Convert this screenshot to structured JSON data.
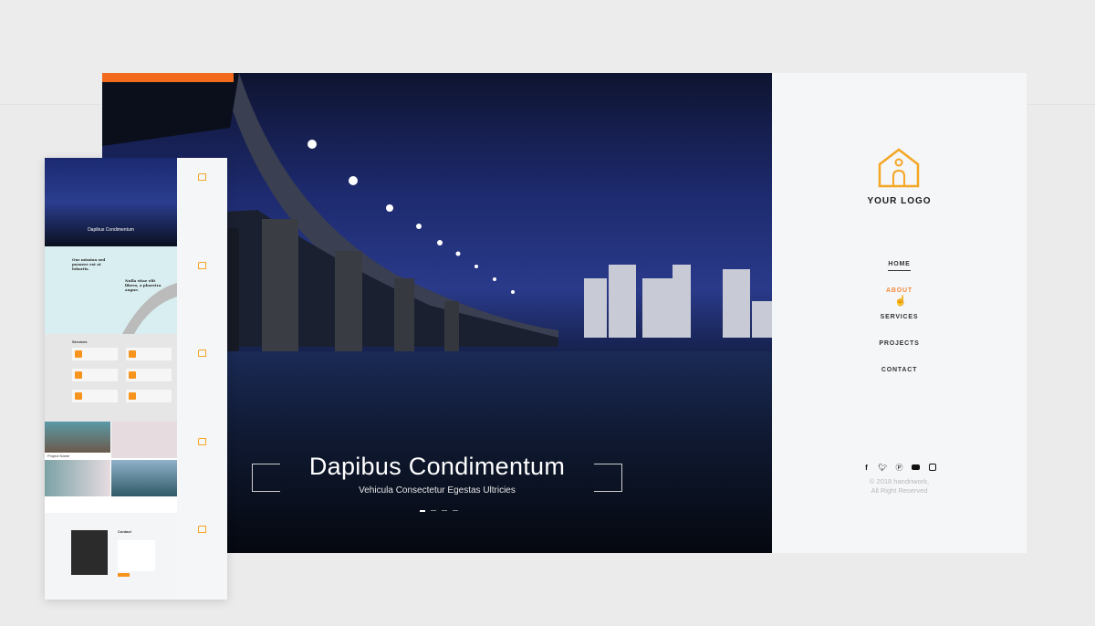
{
  "hero": {
    "title": "Dapibus Condimentum",
    "subtitle": "Vehicula Consectetur Egestas Ultricies",
    "slides": 4,
    "active_slide": 1
  },
  "sidebar": {
    "logo_text": "YOUR LOGO",
    "nav": [
      {
        "label": "HOME"
      },
      {
        "label": "ABOUT"
      },
      {
        "label": "SERVICES"
      },
      {
        "label": "PROJECTS"
      },
      {
        "label": "CONTACT"
      }
    ],
    "social": [
      "facebook-icon",
      "twitter-icon",
      "pinterest-icon",
      "youtube-icon",
      "instagram-icon"
    ],
    "copyright_line1": "© 2018 handriwork,",
    "copyright_line2": "All Right Reserved"
  },
  "mini": {
    "hero_title": "Dapibus Condimentum",
    "mission_heading": "Our mission sed posuere est at lobortis.",
    "mission_heading2": "Nulla vitae elit libero, a pharetra augue.",
    "services_title": "Services",
    "project_name": "Project Name",
    "contact_title": "Contact"
  },
  "colors": {
    "accent": "#f26a1b",
    "logo": "#f5a623",
    "active_nav": "#f58a3c"
  }
}
